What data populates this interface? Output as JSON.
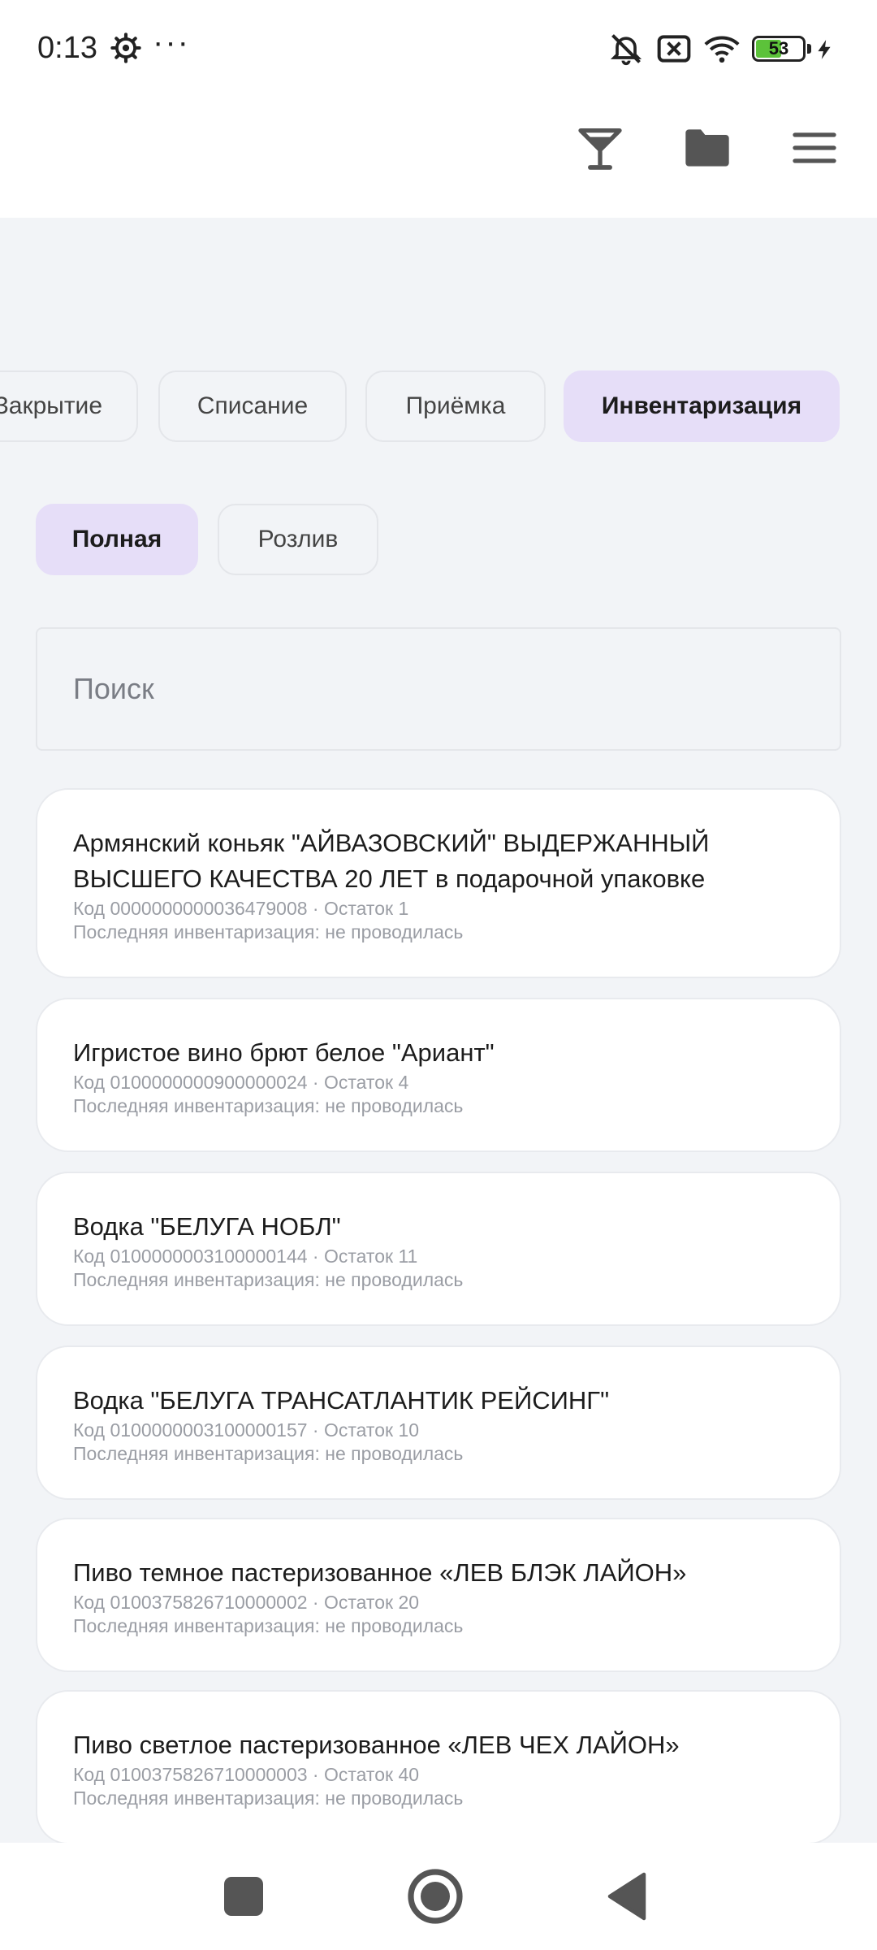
{
  "status_bar": {
    "time": "0:13",
    "dots": "···",
    "battery": "53"
  },
  "toolbar": {
    "icons": [
      "cocktail-icon",
      "folder-icon",
      "menu-icon"
    ]
  },
  "tabs": [
    {
      "label": "Закрытие",
      "active": false
    },
    {
      "label": "Списание",
      "active": false
    },
    {
      "label": "Приёмка",
      "active": false
    },
    {
      "label": "Инвентаризация",
      "active": true
    }
  ],
  "chips": [
    {
      "label": "Полная",
      "active": true
    },
    {
      "label": "Розлив",
      "active": false
    }
  ],
  "search": {
    "placeholder": "Поиск",
    "value": ""
  },
  "items": [
    {
      "title": "Армянский коньяк \"АЙВАЗОВСКИЙ\" ВЫДЕРЖАННЫЙ ВЫСШЕГО КАЧЕСТВА 20 ЛЕТ в подарочной упаковке",
      "code_line": "Код 0000000000036479008 · Остаток 1",
      "last_line": "Последняя инвентаризация: не проводилась"
    },
    {
      "title": "Игристое вино брют белое \"Ариант\"",
      "code_line": "Код 0100000000900000024 · Остаток 4",
      "last_line": "Последняя инвентаризация: не проводилась"
    },
    {
      "title": "Водка \"БЕЛУГА НОБЛ\"",
      "code_line": "Код 0100000003100000144 · Остаток 11",
      "last_line": "Последняя инвентаризация: не проводилась"
    },
    {
      "title": "Водка \"БЕЛУГА ТРАНСАТЛАНТИК РЕЙСИНГ\"",
      "code_line": "Код 0100000003100000157 · Остаток 10",
      "last_line": "Последняя инвентаризация: не проводилась"
    },
    {
      "title": "Пиво темное пастеризованное «ЛЕВ БЛЭК ЛАЙОН»",
      "code_line": "Код 0100375826710000002 · Остаток 20",
      "last_line": "Последняя инвентаризация: не проводилась"
    },
    {
      "title": "Пиво светлое пастеризованное «ЛЕВ ЧЕХ ЛАЙОН»",
      "code_line": "Код 0100375826710000003 · Остаток 40",
      "last_line": "Последняя инвентаризация: не проводилась"
    }
  ],
  "colors": {
    "background": "#f2f4f7",
    "active_chip": "#e6def8",
    "battery_fill": "#5cc23a"
  }
}
